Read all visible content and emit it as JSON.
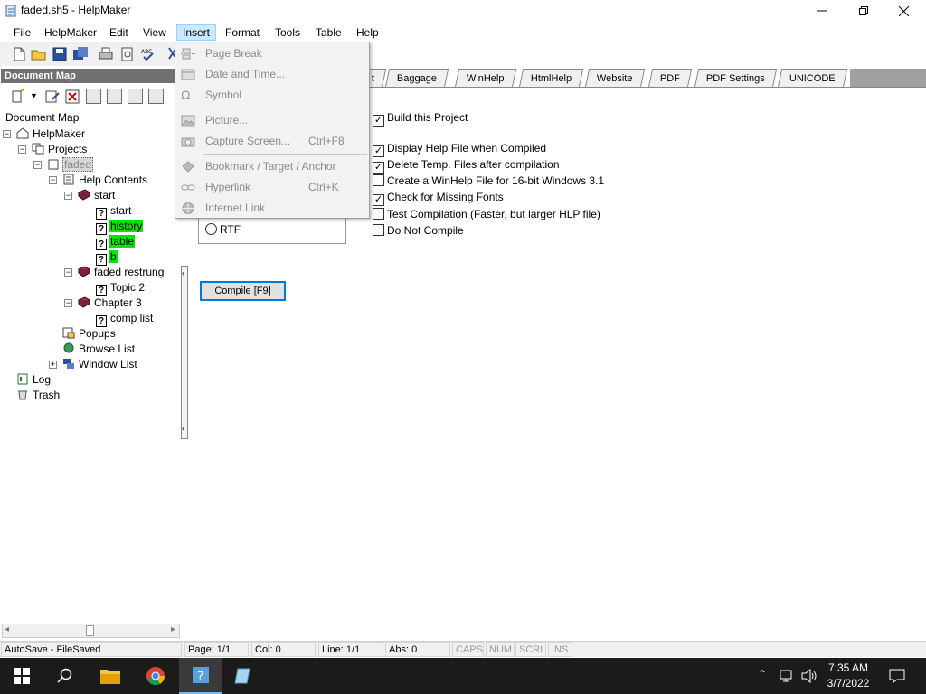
{
  "window": {
    "title": "faded.sh5 - HelpMaker"
  },
  "menubar": {
    "items": [
      {
        "label": "File"
      },
      {
        "label": "HelpMaker"
      },
      {
        "label": "Edit"
      },
      {
        "label": "View"
      },
      {
        "label": "Insert"
      },
      {
        "label": "Format"
      },
      {
        "label": "Tools"
      },
      {
        "label": "Table"
      },
      {
        "label": "Help"
      }
    ]
  },
  "insert_menu": {
    "items": [
      {
        "label": "Page Break",
        "shortcut": "",
        "icon": "page-break-icon",
        "enabled": false
      },
      {
        "label": "Date and Time...",
        "shortcut": "",
        "icon": "calendar-icon",
        "enabled": false
      },
      {
        "label": "Symbol",
        "shortcut": "",
        "icon": "omega-icon",
        "enabled": false
      },
      {
        "label": "Picture...",
        "shortcut": "",
        "icon": "picture-icon",
        "enabled": false
      },
      {
        "label": "Capture Screen...",
        "shortcut": "Ctrl+F8",
        "icon": "camera-icon",
        "enabled": false
      },
      {
        "label": "Bookmark / Target / Anchor",
        "shortcut": "",
        "icon": "bookmark-icon",
        "enabled": false
      },
      {
        "label": "Hyperlink",
        "shortcut": "Ctrl+K",
        "icon": "chain-link-icon",
        "enabled": false
      },
      {
        "label": "Internet Link",
        "shortcut": "",
        "icon": "globe-icon",
        "enabled": false
      }
    ]
  },
  "document_map": {
    "header": "Document Map",
    "label": "Document Map",
    "tree": {
      "root": "HelpMaker",
      "projects": "Projects",
      "faded": "faded",
      "help_contents": "Help Contents",
      "start_book": "start",
      "start_topic": "start",
      "history": "history",
      "table": "table",
      "b": "b",
      "faded_restrung": "faded restrung",
      "topic2": "Topic 2",
      "chapter3": "Chapter 3",
      "comp_list": "comp list",
      "popups": "Popups",
      "browse_list": "Browse List",
      "window_list": "Window List",
      "log": "Log",
      "trash": "Trash"
    }
  },
  "tabs": [
    {
      "label": "t"
    },
    {
      "label": "Baggage"
    },
    {
      "label": "WinHelp"
    },
    {
      "label": "HtmlHelp"
    },
    {
      "label": "Website"
    },
    {
      "label": "PDF"
    },
    {
      "label": "PDF Settings"
    },
    {
      "label": "UNICODE"
    }
  ],
  "options": {
    "build_project": {
      "label": "Build this Project",
      "checked": true
    },
    "display_help": {
      "label": "Display Help File when Compiled",
      "checked": true
    },
    "delete_temp": {
      "label": "Delete Temp. Files after compilation",
      "checked": true
    },
    "winhelp16": {
      "label": "Create a WinHelp File for 16-bit Windows 3.1",
      "checked": false
    },
    "missing_fonts": {
      "label": "Check for Missing Fonts",
      "checked": true
    },
    "test_compile": {
      "label": "Test Compilation (Faster, but larger HLP file)",
      "checked": false
    },
    "no_compile": {
      "label": "Do Not Compile",
      "checked": false
    },
    "rtf": {
      "label": "RTF",
      "selected": false
    },
    "compile_button": "Compile [F9]"
  },
  "statusbar": {
    "autosave": "AutoSave - FileSaved",
    "page": "Page: 1/1",
    "col": "Col: 0",
    "line": "Line: 1/1",
    "abs": "Abs: 0",
    "caps": "CAPS",
    "num": "NUM",
    "scrl": "SCRL",
    "ins": "INS"
  },
  "taskbar": {
    "time": "7:35 AM",
    "date": "3/7/2022"
  },
  "colors": {
    "highlight": "#00e600",
    "menu_active": "#cce8ff",
    "taskbar": "#1b1b1b"
  }
}
